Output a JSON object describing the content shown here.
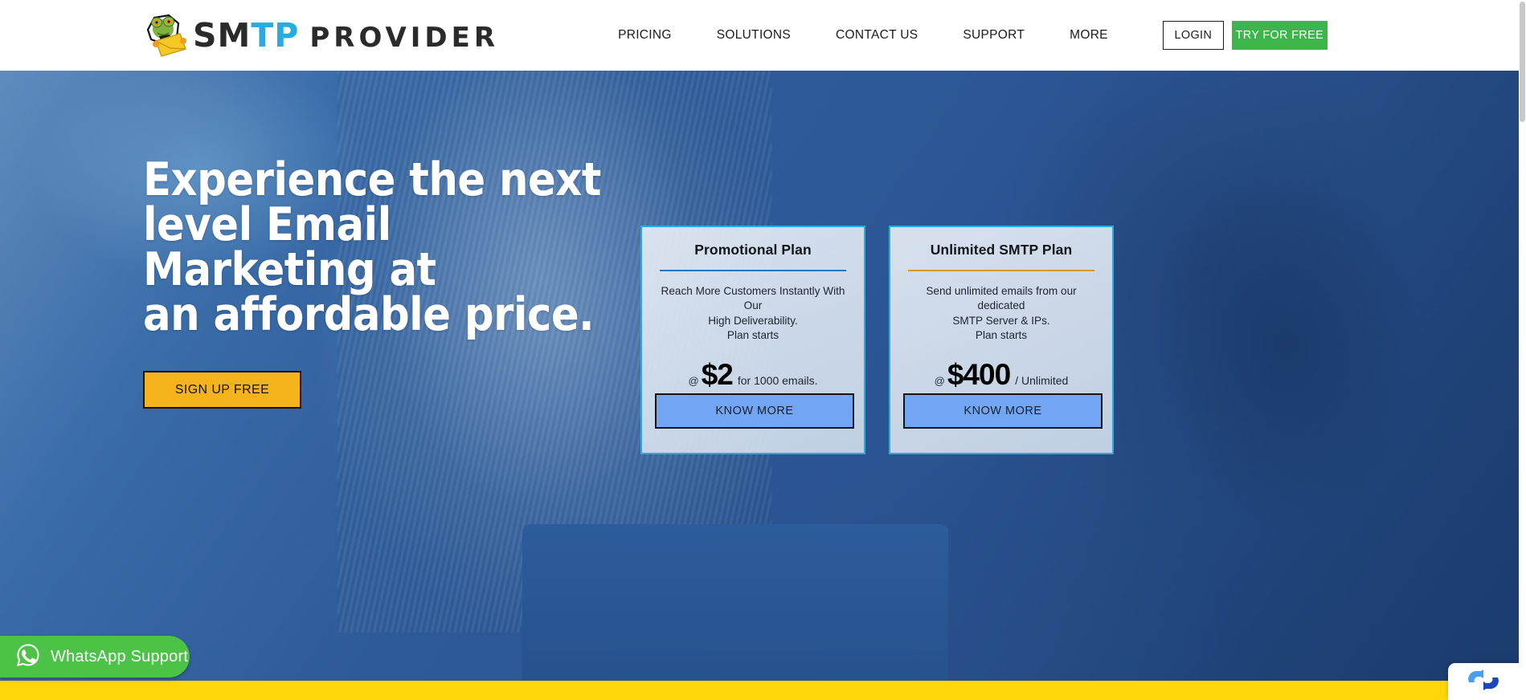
{
  "header": {
    "logo": {
      "icon": "frog-envelope-logo-icon",
      "text_part1": "SM",
      "text_part2": "TP",
      "text_part3": "PROVIDER",
      "accent_color": "#29abe2",
      "dark_color": "#2b2b2b"
    },
    "nav_items": [
      {
        "label": "PRICING",
        "name": "nav-item-pricing"
      },
      {
        "label": "SOLUTIONS",
        "name": "nav-item-solutions"
      },
      {
        "label": "CONTACT US",
        "name": "nav-item-contact-us"
      },
      {
        "label": "SUPPORT",
        "name": "nav-item-support"
      },
      {
        "label": "MORE",
        "name": "nav-item-more"
      }
    ],
    "login_label": "LOGIN",
    "try_free_label": "TRY FOR FREE",
    "try_free_color": "#3cb54a"
  },
  "hero": {
    "title": "Experience the next\nlevel Email\nMarketing at\nan affordable price.",
    "signup_label": "SIGN UP FREE",
    "signup_color": "#f6b31c"
  },
  "plans": [
    {
      "name": "plan-card-promotional",
      "title": "Promotional Plan",
      "divider_color": "#2777c0",
      "description": "Reach More Customers Instantly With Our\nHigh Deliverability.\nPlan starts",
      "price_at": "@",
      "price_amount": "$2",
      "price_unit": "for 1000 emails.",
      "cta_label": "KNOW MORE"
    },
    {
      "name": "plan-card-unlimited",
      "title": "Unlimited SMTP Plan",
      "divider_color": "#d29b2c",
      "description": "Send unlimited emails from our dedicated\nSMTP Server & IPs.\nPlan starts",
      "price_at": "@",
      "price_amount": "$400",
      "price_unit": "/ Unlimited",
      "cta_label": "KNOW MORE"
    }
  ],
  "widgets": {
    "whatsapp_label": "WhatsApp Support",
    "whatsapp_color": "#4cc247",
    "whatsapp_icon": "whatsapp-icon",
    "sync_icon": "sync-arrows-icon",
    "bottom_bar_color": "#ffd60a"
  }
}
